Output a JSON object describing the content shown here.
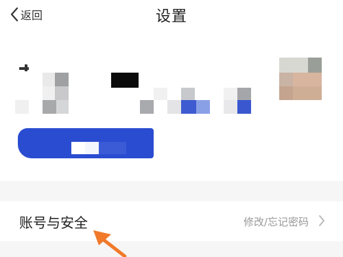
{
  "header": {
    "back_label": "返回",
    "title": "设置"
  },
  "icons": {
    "back": "chevron-left-icon",
    "row_chevron": "chevron-right-icon",
    "annotation": "arrow-icon"
  },
  "settings": {
    "items": [
      {
        "label": "账号与安全",
        "hint": "修改/忘记密码"
      }
    ]
  },
  "colors": {
    "accent_blue": "#2a4cd1",
    "annotation_orange": "#f07a2a",
    "hint_gray": "#999999"
  }
}
